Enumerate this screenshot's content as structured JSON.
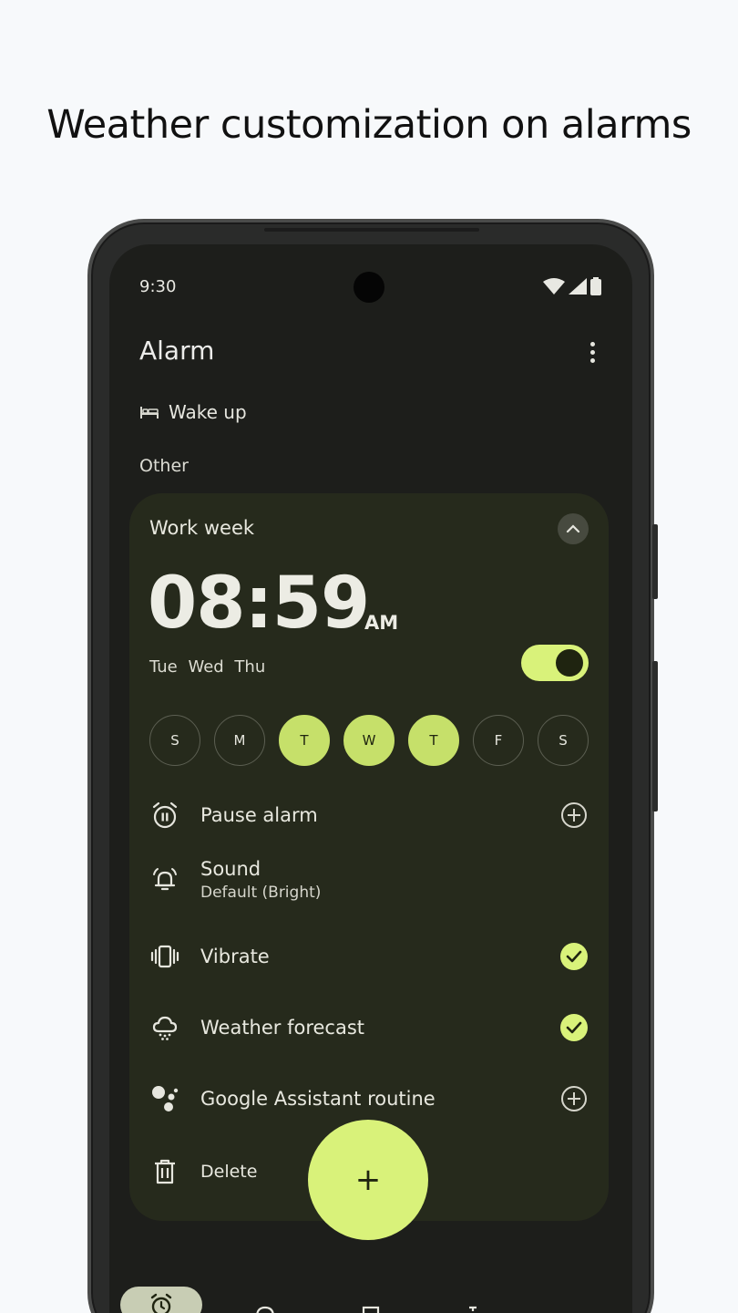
{
  "headline": "Weather customization on alarms",
  "status_bar": {
    "time": "9:30"
  },
  "app": {
    "title": "Alarm"
  },
  "bedtime": {
    "label": "Wake up"
  },
  "section": {
    "label": "Other"
  },
  "alarm": {
    "label": "Work week",
    "time": "08:59",
    "ampm": "AM",
    "days_summary": "Tue Wed Thu",
    "enabled": true,
    "days": [
      {
        "letter": "S",
        "on": false
      },
      {
        "letter": "M",
        "on": false
      },
      {
        "letter": "T",
        "on": true
      },
      {
        "letter": "W",
        "on": true
      },
      {
        "letter": "T",
        "on": true
      },
      {
        "letter": "F",
        "on": false
      },
      {
        "letter": "S",
        "on": false
      }
    ],
    "options": {
      "pause": {
        "label": "Pause alarm",
        "icon": "pause-alarm-icon",
        "action": "add"
      },
      "sound": {
        "label": "Sound",
        "value": "Default (Bright)",
        "icon": "bell-icon"
      },
      "vibrate": {
        "label": "Vibrate",
        "icon": "vibrate-icon",
        "action": "checked"
      },
      "weather": {
        "label": "Weather forecast",
        "icon": "weather-icon",
        "action": "checked"
      },
      "assistant": {
        "label": "Google Assistant routine",
        "icon": "assistant-icon",
        "action": "add"
      },
      "delete": {
        "label": "Delete",
        "icon": "trash-icon"
      }
    }
  },
  "fab": {
    "label": "+"
  },
  "colors": {
    "accent": "#d9f27a",
    "card": "#262a1c",
    "screen": "#1d1e1b"
  }
}
